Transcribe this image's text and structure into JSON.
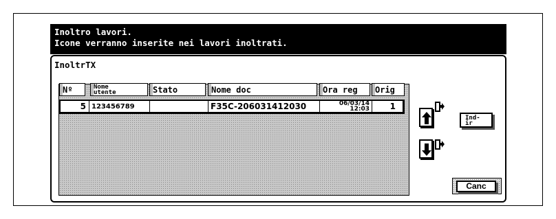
{
  "header": {
    "line1": "Inoltro lavori.",
    "line2": "Icone verranno inserite nei lavori inoltrati."
  },
  "panel": {
    "title": "InoltrTX"
  },
  "table": {
    "columns": [
      "Nº",
      "Nome utente",
      "Stato",
      "Nome doc",
      "Ora reg",
      "Orig"
    ],
    "rows": [
      {
        "no": "5",
        "user": "123456789",
        "status": "",
        "doc": "F35C-206031412030",
        "date": "06/03/14",
        "time": "12:03",
        "orig": "1"
      }
    ]
  },
  "buttons": {
    "up": "up-arrow",
    "down": "down-arrow",
    "forward_line1": "Ind-",
    "forward_line2": "ir",
    "cancel": "Canc"
  }
}
